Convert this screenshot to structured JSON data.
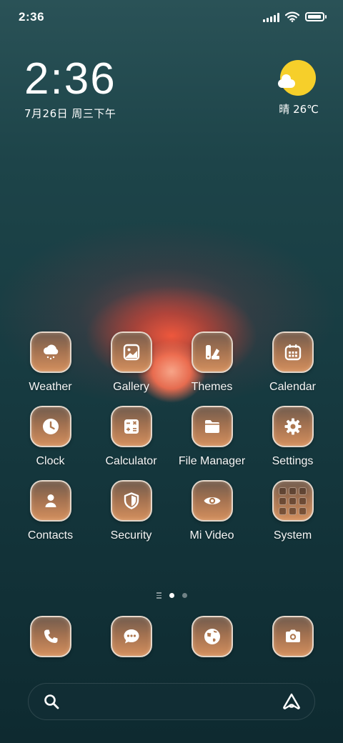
{
  "status_bar": {
    "time": "2:36",
    "battery_level": 0.95
  },
  "clock_widget": {
    "time": "2:36",
    "date": "7月26日 周三下午"
  },
  "weather_widget": {
    "condition_icon": "sun-cloud-icon",
    "text": "晴 26℃"
  },
  "apps": [
    {
      "label": "Weather",
      "icon": "weather-icon"
    },
    {
      "label": "Gallery",
      "icon": "gallery-icon"
    },
    {
      "label": "Themes",
      "icon": "themes-icon"
    },
    {
      "label": "Calendar",
      "icon": "calendar-icon"
    },
    {
      "label": "Clock",
      "icon": "clock-icon"
    },
    {
      "label": "Calculator",
      "icon": "calculator-icon"
    },
    {
      "label": "File Manager",
      "icon": "folder-icon"
    },
    {
      "label": "Settings",
      "icon": "gear-icon"
    },
    {
      "label": "Contacts",
      "icon": "person-icon"
    },
    {
      "label": "Security",
      "icon": "shield-icon"
    },
    {
      "label": "Mi Video",
      "icon": "eye-icon"
    },
    {
      "label": "System",
      "icon": "folder-grid-icon"
    }
  ],
  "page_indicator": {
    "pages": 2,
    "current": 1
  },
  "dock": [
    {
      "icon": "phone-icon"
    },
    {
      "icon": "message-icon"
    },
    {
      "icon": "globe-icon"
    },
    {
      "icon": "camera-icon"
    }
  ],
  "search_bar": {
    "left_icon": "search-icon",
    "right_icon": "assistant-icon"
  },
  "colors": {
    "icon_tile": "#d38f5e",
    "sun": "#f6cf2a",
    "wallpaper_top": "#2a5257",
    "wallpaper_bottom": "#0e2a30"
  }
}
